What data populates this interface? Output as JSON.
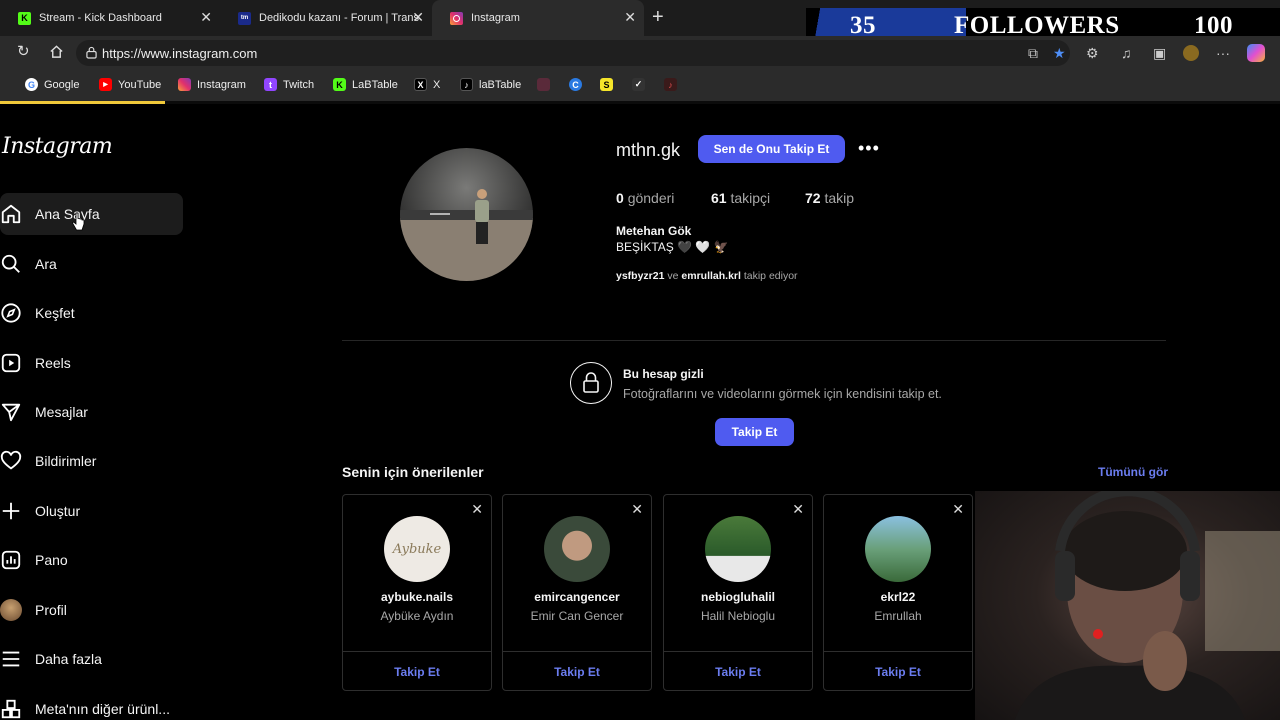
{
  "browser": {
    "tabs": [
      {
        "title": "Stream - Kick Dashboard",
        "icon": "kick-icon",
        "color": "#53fc18"
      },
      {
        "title": "Dedikodu kazanı - Forum | Transfe",
        "icon": "forum-icon",
        "color": "#1a2a8a"
      },
      {
        "title": "Instagram",
        "icon": "instagram-icon",
        "color": "#e1306c"
      }
    ],
    "url": "https://www.instagram.com",
    "bookmarks": [
      "Google",
      "YouTube",
      "Instagram",
      "Twitch",
      "LaBTable",
      "X",
      "laBTable"
    ]
  },
  "overlay": {
    "count": "35",
    "label": "FOLLOWERS",
    "goal": "100"
  },
  "sidebar": {
    "logo": "Instagram",
    "items": [
      {
        "label": "Ana Sayfa",
        "icon": "home-icon"
      },
      {
        "label": "Ara",
        "icon": "search-icon"
      },
      {
        "label": "Keşfet",
        "icon": "compass-icon"
      },
      {
        "label": "Reels",
        "icon": "reels-icon"
      },
      {
        "label": "Mesajlar",
        "icon": "messenger-icon"
      },
      {
        "label": "Bildirimler",
        "icon": "heart-icon"
      },
      {
        "label": "Oluştur",
        "icon": "plus-icon"
      },
      {
        "label": "Pano",
        "icon": "dashboard-icon"
      },
      {
        "label": "Profil",
        "icon": "profile-avatar-icon"
      },
      {
        "label": "Daha fazla",
        "icon": "menu-icon"
      },
      {
        "label": "Meta'nın diğer ürünl...",
        "icon": "apps-icon"
      }
    ]
  },
  "profile": {
    "username": "mthn.gk",
    "follow_label": "Sen de Onu Takip Et",
    "posts_count": "0",
    "posts_label": "gönderi",
    "followers_count": "61",
    "followers_label": "takipçi",
    "following_count": "72",
    "following_label": "takip",
    "full_name": "Metehan Gök",
    "bio": "BEŞİKTAŞ 🖤 🤍 🦅",
    "followed_by_1": "ysfbyzr21",
    "followed_by_sep": "ve",
    "followed_by_2": "emrullah.krl",
    "followed_by_suffix": "takip ediyor"
  },
  "private": {
    "title": "Bu hesap gizli",
    "subtitle": "Fotoğraflarını ve videolarını görmek için kendisini takip et.",
    "follow_label": "Takip Et"
  },
  "suggestions": {
    "title": "Senin için önerilenler",
    "see_all": "Tümünü gör",
    "cards": [
      {
        "username": "aybuke.nails",
        "name": "Aybüke Aydın",
        "follow": "Takip Et",
        "avatar_text": "Aybuke"
      },
      {
        "username": "emircangencer",
        "name": "Emir Can Gencer",
        "follow": "Takip Et"
      },
      {
        "username": "nebiogluhalil",
        "name": "Halil Nebioglu",
        "follow": "Takip Et"
      },
      {
        "username": "ekrl22",
        "name": "Emrullah",
        "follow": "Takip Et"
      }
    ]
  }
}
